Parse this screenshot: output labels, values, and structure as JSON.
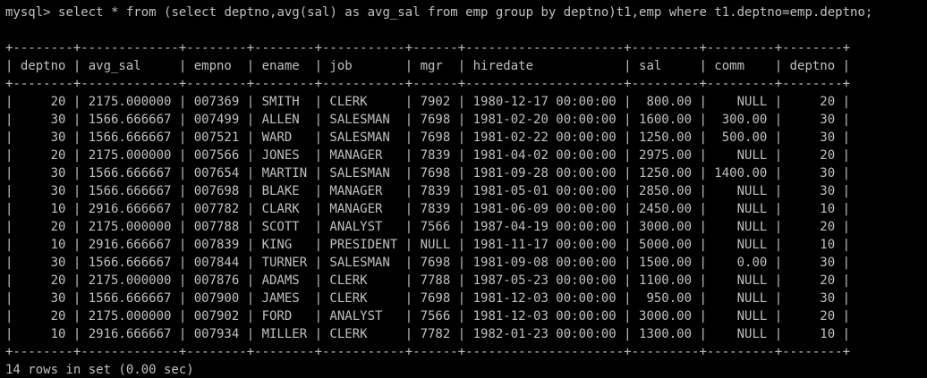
{
  "terminal": {
    "background": "#000000",
    "foreground": "#c0c0c0",
    "prompt": "mysql> ",
    "command": "select * from (select deptno,avg(sal) as avg_sal from emp group by deptno)t1,emp where t1.deptno=emp.deptno;",
    "result": "14 rows in set (0.00 sec)"
  },
  "table": {
    "columns": [
      "deptno",
      "avg_sal",
      "empno",
      "ename",
      "job",
      "mgr",
      "hiredate",
      "sal",
      "comm",
      "deptno"
    ],
    "rows": [
      [
        "20",
        "2175.000000",
        "007369",
        "SMITH",
        "CLERK",
        "7902",
        "1980-12-17 00:00:00",
        "800.00",
        "NULL",
        "20"
      ],
      [
        "30",
        "1566.666667",
        "007499",
        "ALLEN",
        "SALESMAN",
        "7698",
        "1981-02-20 00:00:00",
        "1600.00",
        "300.00",
        "30"
      ],
      [
        "30",
        "1566.666667",
        "007521",
        "WARD",
        "SALESMAN",
        "7698",
        "1981-02-22 00:00:00",
        "1250.00",
        "500.00",
        "30"
      ],
      [
        "20",
        "2175.000000",
        "007566",
        "JONES",
        "MANAGER",
        "7839",
        "1981-04-02 00:00:00",
        "2975.00",
        "NULL",
        "20"
      ],
      [
        "30",
        "1566.666667",
        "007654",
        "MARTIN",
        "SALESMAN",
        "7698",
        "1981-09-28 00:00:00",
        "1250.00",
        "1400.00",
        "30"
      ],
      [
        "30",
        "1566.666667",
        "007698",
        "BLAKE",
        "MANAGER",
        "7839",
        "1981-05-01 00:00:00",
        "2850.00",
        "NULL",
        "30"
      ],
      [
        "10",
        "2916.666667",
        "007782",
        "CLARK",
        "MANAGER",
        "7839",
        "1981-06-09 00:00:00",
        "2450.00",
        "NULL",
        "10"
      ],
      [
        "20",
        "2175.000000",
        "007788",
        "SCOTT",
        "ANALYST",
        "7566",
        "1987-04-19 00:00:00",
        "3000.00",
        "NULL",
        "20"
      ],
      [
        "10",
        "2916.666667",
        "007839",
        "KING",
        "PRESIDENT",
        "NULL",
        "1981-11-17 00:00:00",
        "5000.00",
        "NULL",
        "10"
      ],
      [
        "30",
        "1566.666667",
        "007844",
        "TURNER",
        "SALESMAN",
        "7698",
        "1981-09-08 00:00:00",
        "1500.00",
        "0.00",
        "30"
      ],
      [
        "20",
        "2175.000000",
        "007876",
        "ADAMS",
        "CLERK",
        "7788",
        "1987-05-23 00:00:00",
        "1100.00",
        "NULL",
        "20"
      ],
      [
        "30",
        "1566.666667",
        "007900",
        "JAMES",
        "CLERK",
        "7698",
        "1981-12-03 00:00:00",
        "950.00",
        "NULL",
        "30"
      ],
      [
        "20",
        "2175.000000",
        "007902",
        "FORD",
        "ANALYST",
        "7566",
        "1981-12-03 00:00:00",
        "3000.00",
        "NULL",
        "20"
      ],
      [
        "10",
        "2916.666667",
        "007934",
        "MILLER",
        "CLERK",
        "7782",
        "1982-01-23 00:00:00",
        "1300.00",
        "NULL",
        "10"
      ]
    ]
  }
}
